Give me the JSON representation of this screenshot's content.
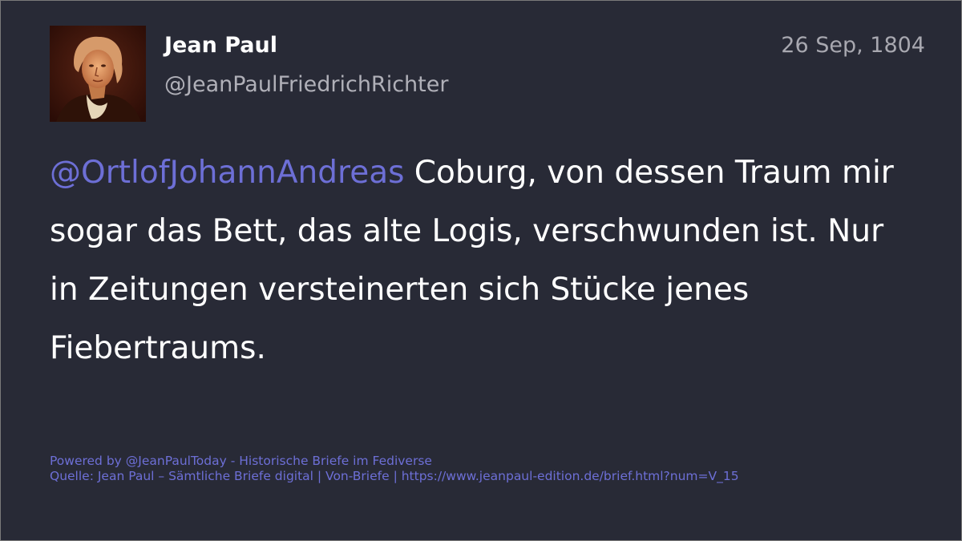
{
  "post": {
    "author_name": "Jean Paul",
    "author_handle": "@JeanPaulFriedrichRichter",
    "date": "26 Sep, 1804",
    "mention": "@OrtlofJohannAndreas",
    "text": " Coburg, von dessen Traum mir sogar das Bett, das alte Logis, verschwunden ist. Nur in Zeitungen versteinerten sich Stücke jenes Fiebertraums."
  },
  "footer": {
    "powered_by": "Powered by @JeanPaulToday - Historische Briefe im Fediverse",
    "source": "Quelle: Jean Paul – Sämtliche Briefe digital | Von-Briefe | https://www.jeanpaul-edition.de/brief.html?num=V_15"
  },
  "colors": {
    "background": "#282a36",
    "accent": "#6d6fd6",
    "text": "#ffffff",
    "muted": "#a8a8b0"
  }
}
